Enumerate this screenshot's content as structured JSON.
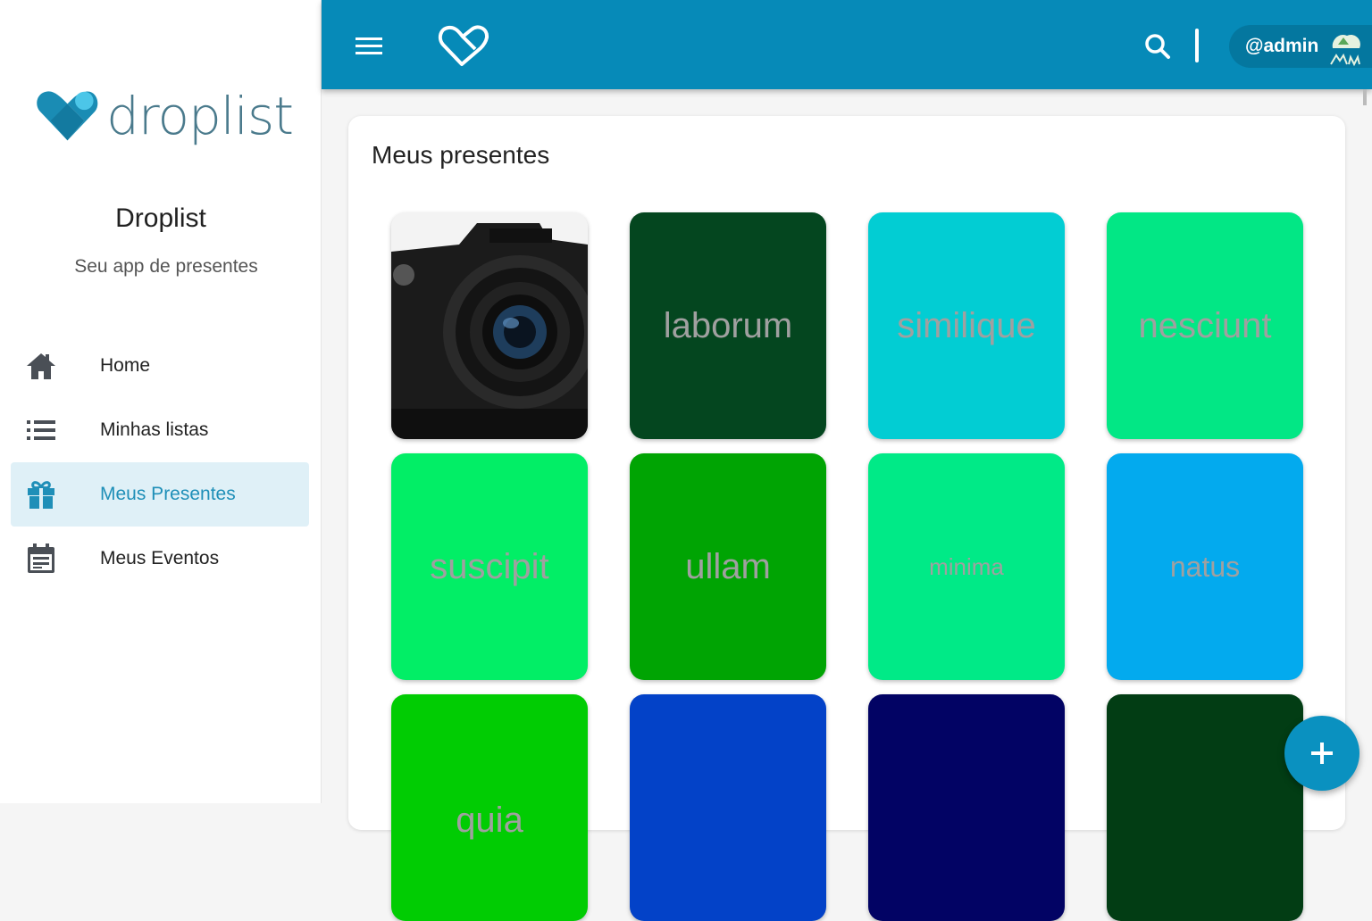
{
  "brand": {
    "name": "droplist"
  },
  "sidebar": {
    "title": "Droplist",
    "subtitle": "Seu app de presentes",
    "items": [
      {
        "label": "Home",
        "icon": "home-icon",
        "active": false
      },
      {
        "label": "Minhas listas",
        "icon": "list-icon",
        "active": false
      },
      {
        "label": "Meus Presentes",
        "icon": "gift-icon",
        "active": true
      },
      {
        "label": "Meus Eventos",
        "icon": "calendar-icon",
        "active": false
      }
    ]
  },
  "topbar": {
    "user": "@admin",
    "icons": [
      "menu-icon",
      "heart-icon",
      "search-icon",
      "avatar-icon"
    ]
  },
  "main": {
    "title": "Meus presentes",
    "gifts": [
      {
        "label": "",
        "color": "#f2f2f2",
        "image": "camera"
      },
      {
        "label": "laborum",
        "color": "#04461f"
      },
      {
        "label": "similique",
        "color": "#02cdd3"
      },
      {
        "label": "nesciunt",
        "color": "#02e785"
      },
      {
        "label": "suscipit",
        "color": "#02ee66"
      },
      {
        "label": "ullam",
        "color": "#00a403"
      },
      {
        "label": "minima",
        "color": "#00ea87"
      },
      {
        "label": "natus",
        "color": "#03aaee"
      },
      {
        "label": "quia",
        "color": "#01cc03"
      },
      {
        "label": "",
        "color": "#0342c8"
      },
      {
        "label": "",
        "color": "#020364"
      },
      {
        "label": "",
        "color": "#023d14"
      }
    ]
  },
  "colors": {
    "primary": "#068ab8",
    "active_bg": "#dff0f7",
    "active_text": "#1f8fb8",
    "fab": "#0a91c0"
  },
  "fab": {
    "icon": "plus-icon"
  }
}
